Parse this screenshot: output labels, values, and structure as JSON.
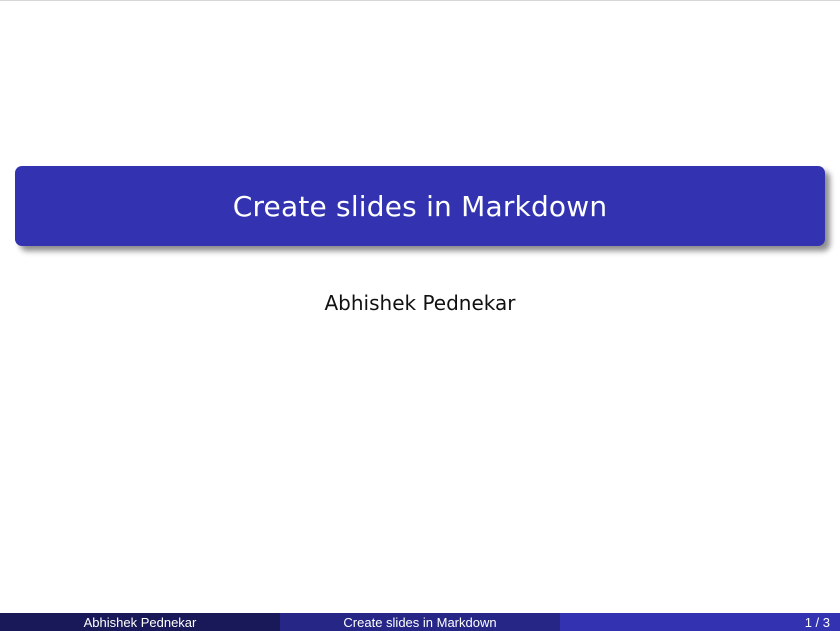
{
  "colors": {
    "accent": "#3333b2",
    "footer_dark": "#191959",
    "footer_mid": "#262686"
  },
  "slide": {
    "title": "Create slides in Markdown",
    "author": "Abhishek Pednekar"
  },
  "footer": {
    "author": "Abhishek Pednekar",
    "title": "Create slides in Markdown",
    "page": "1 / 3"
  }
}
